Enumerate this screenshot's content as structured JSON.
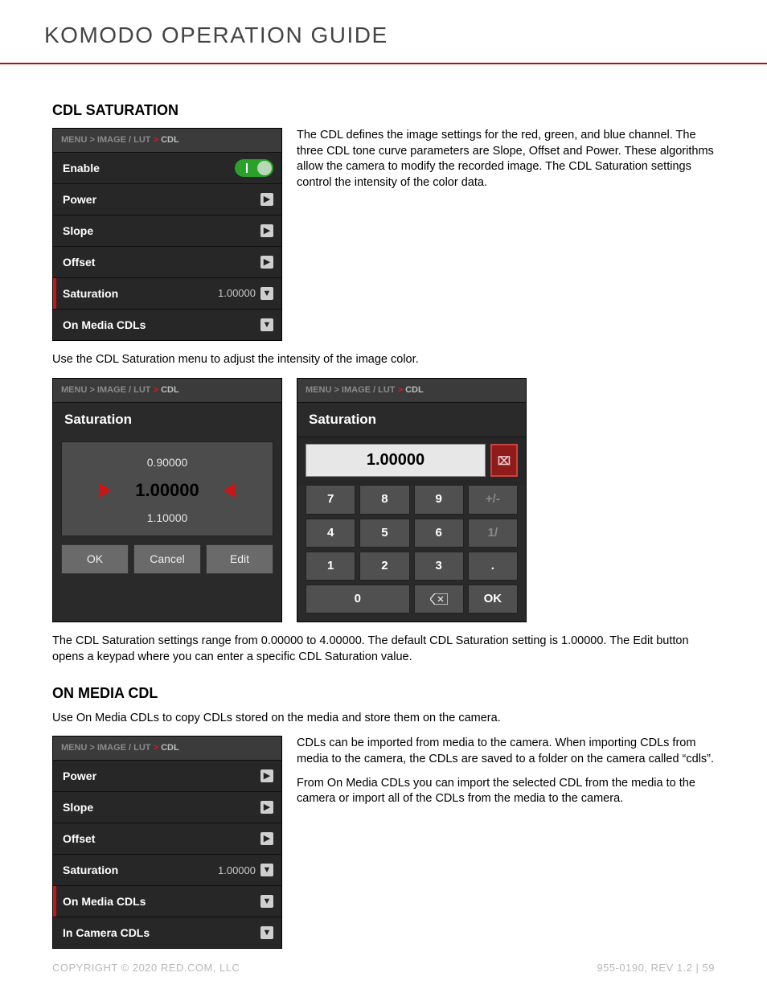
{
  "header": {
    "title": "KOMODO OPERATION GUIDE"
  },
  "section1": {
    "heading": "CDL SATURATION",
    "breadcrumb": {
      "pre": "MENU > IMAGE / LUT",
      "last": "CDL"
    },
    "menu": {
      "enable": "Enable",
      "power": "Power",
      "slope": "Slope",
      "offset": "Offset",
      "saturation": "Saturation",
      "saturation_value": "1.00000",
      "onmedia": "On Media CDLs"
    },
    "para1": "The CDL defines the image settings for the red, green, and blue channel. The three CDL tone curve parameters are Slope, Offset and Power. These algorithms allow the camera to modify the recorded image. The CDL Saturation settings control the intensity of the color data.",
    "para2": "Use the CDL Saturation menu to adjust the intensity of the image color."
  },
  "spinnerPanel": {
    "title": "Saturation",
    "prev": "0.90000",
    "cur": "1.00000",
    "next": "1.10000",
    "ok": "OK",
    "cancel": "Cancel",
    "edit": "Edit"
  },
  "keypadPanel": {
    "title": "Saturation",
    "display": "1.00000",
    "k7": "7",
    "k8": "8",
    "k9": "9",
    "kpm": "+/-",
    "k4": "4",
    "k5": "5",
    "k6": "6",
    "kslash": "1/",
    "k1": "1",
    "k2": "2",
    "k3": "3",
    "kd": ".",
    "k0": "0",
    "kok": "OK"
  },
  "para3": "The CDL Saturation settings range from 0.00000 to 4.00000. The default CDL Saturation setting is 1.00000. The Edit button opens a keypad where you can enter a specific CDL Saturation value.",
  "section2": {
    "heading": "ON MEDIA CDL",
    "intro": "Use On Media CDLs to copy CDLs stored on the media and store them on the camera.",
    "menu": {
      "power": "Power",
      "slope": "Slope",
      "offset": "Offset",
      "saturation": "Saturation",
      "saturation_value": "1.00000",
      "onmedia": "On Media CDLs",
      "incamera": "In Camera CDLs"
    },
    "para1": "CDLs can be imported from media to the camera. When importing CDLs from media to the camera, the CDLs are saved to a folder on the camera called “cdls”.",
    "para2": "From On Media CDLs you can import the selected CDL from the media to the camera or import all of the CDLs from the media to the camera."
  },
  "footer": {
    "left": "COPYRIGHT © 2020 RED.COM, LLC",
    "right": "955-0190, REV 1.2  |  59"
  }
}
